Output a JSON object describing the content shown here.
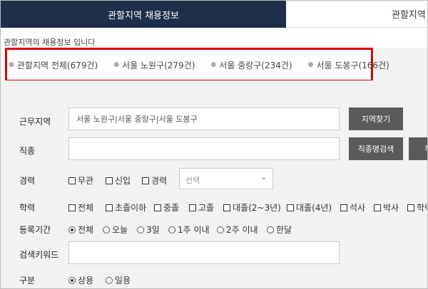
{
  "tabs": {
    "active": "관할지역 채용정보",
    "inactive": "관할지역"
  },
  "info_text": "관할지역의 채용정보 입니다",
  "summary": [
    "관할지역 전체(679건)",
    "서울 노원구(279건)",
    "서울 중랑구(234건)",
    "서울 도봉구(166건)"
  ],
  "form": {
    "work_area": {
      "label": "근무지역",
      "value": "서울 노원구|서울 중랑구|서울 도봉구",
      "button": "지역찾기"
    },
    "job_type": {
      "label": "직종",
      "value": "",
      "button": "직종명검색",
      "button_partial": "직"
    },
    "career": {
      "label": "경력",
      "options": [
        "무관",
        "신입",
        "경력"
      ],
      "select_placeholder": "선택"
    },
    "education": {
      "label": "학력",
      "options": [
        "전체",
        "초졸이하",
        "중졸",
        "고졸",
        "대졸(2~3년)",
        "대졸(4년)",
        "석사",
        "박사",
        "학력"
      ]
    },
    "period": {
      "label": "등록기간",
      "options": [
        "전체",
        "오늘",
        "3일",
        "1주 이내",
        "2주 이내",
        "한달"
      ],
      "selected": "전체"
    },
    "keyword": {
      "label": "검색키워드",
      "value": ""
    },
    "category": {
      "label": "구분",
      "options": [
        "상용",
        "일용"
      ],
      "selected": "상용"
    }
  },
  "colors": {
    "tab_active_bg": "#1f2f4a",
    "highlight_border": "#e00000",
    "button_bg": "#5a5a5a",
    "form_bg": "#f2f2f2"
  }
}
